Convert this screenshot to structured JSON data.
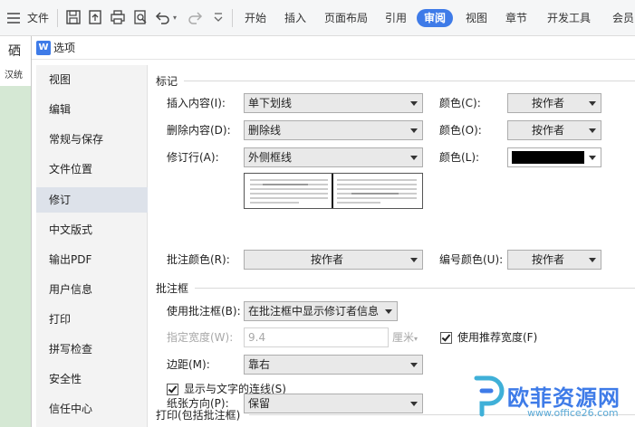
{
  "ribbon": {
    "menu": "文件",
    "tabs": [
      "开始",
      "插入",
      "页面布局",
      "引用",
      "审阅",
      "视图",
      "章节",
      "开发工具",
      "会员"
    ],
    "active_tab": "审阅",
    "accent": "#3e7be8"
  },
  "background_doc": {
    "chars": "硒",
    "chars2": "汉统"
  },
  "dialog": {
    "title": "选项",
    "logo": "W",
    "nav": [
      "视图",
      "编辑",
      "常规与保存",
      "文件位置",
      "修订",
      "中文版式",
      "输出PDF",
      "用户信息",
      "打印",
      "拼写检查",
      "安全性",
      "信任中心"
    ],
    "nav_active": "修订"
  },
  "markup": {
    "section": "标记",
    "insert_label": "插入内容(I):",
    "insert_value": "单下划线",
    "insert_color_label": "颜色(C):",
    "insert_color_value": "按作者",
    "delete_label": "删除内容(D):",
    "delete_value": "删除线",
    "delete_color_label": "颜色(O):",
    "delete_color_value": "按作者",
    "line_label": "修订行(A):",
    "line_value": "外侧框线",
    "line_color_label": "颜色(L):",
    "line_color_swatch": "#000000",
    "comment_color_label": "批注颜色(R):",
    "comment_color_value": "按作者",
    "number_color_label": "编号颜色(U):",
    "number_color_value": "按作者"
  },
  "balloons": {
    "section": "批注框",
    "use_label": "使用批注框(B):",
    "use_value": "在批注框中显示修订者信息",
    "width_label": "指定宽度(W):",
    "width_value": "9.4",
    "width_unit": "厘米",
    "recommended_label": "使用推荐宽度(F)",
    "recommended_checked": true,
    "margin_label": "边距(M):",
    "margin_value": "靠右",
    "lines_label": "显示与文字的连线(S)",
    "lines_checked": true
  },
  "print": {
    "section": "打印(包括批注框)",
    "orientation_label": "纸张方向(P):",
    "orientation_value": "保留"
  },
  "watermark": {
    "text": "欧菲资源网",
    "url": "www.office26.com"
  }
}
